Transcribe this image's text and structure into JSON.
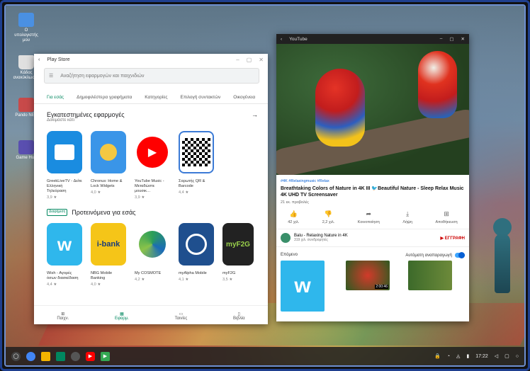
{
  "desktop": {
    "icons": [
      {
        "label": "Ο υπολογιστής μου",
        "icon": "computer-icon",
        "color": "#4a90e2"
      },
      {
        "label": "Κάδος ανακύκλωσης",
        "icon": "trash-icon",
        "color": "#e0e0e0"
      },
      {
        "label": "Pando NES",
        "icon": "pando-icon",
        "color": "#c84a4a"
      },
      {
        "label": "Game Hub",
        "icon": "grid-app-icon",
        "color": "#5a4fb0"
      }
    ]
  },
  "playstore": {
    "title": "Play Store",
    "search_placeholder": "Αναζήτηση εφαρμογών και παιχνιδιών",
    "tabs": [
      "Για εσάς",
      "Δημοφιλέστερα γραφήματα",
      "Κατηγορίες",
      "Επιλογή συντακτών",
      "Οικογένεια"
    ],
    "active_tab": 0,
    "installed": {
      "title": "Εγκατεστημένες εφαρμογές",
      "subtitle": "Δοκιμάστε κάτι",
      "apps": [
        {
          "name": "GreekLiveTV - Δείτε Ελληνική Τηλεόραση",
          "rating": "3,9 ★",
          "color": "#1a8ce0"
        },
        {
          "name": "Chronus: Home & Lock Widgets",
          "rating": "4,0 ★",
          "color": "#3a95e8"
        },
        {
          "name": "YouTube Music - Μεταδώστε μουσικ…",
          "rating": "3,9 ★",
          "color": "#ffffff"
        },
        {
          "name": "Σαρωτής QR & Barcode",
          "rating": "4,4 ★",
          "color": "#ffffff"
        }
      ]
    },
    "recommended": {
      "badge": "Διαφήμιση",
      "title": "Προτεινόμενα για εσάς",
      "apps": [
        {
          "name": "Wish - Αγορές όσων διασκέδαση",
          "rating": "4,4 ★",
          "color": "#2fb7ec",
          "text": "w"
        },
        {
          "name": "NBG Mobile Banking",
          "rating": "4,0 ★",
          "color": "#f5c518",
          "text": "i-bank"
        },
        {
          "name": "My COSMOTE",
          "rating": "4,2 ★",
          "color": "#ffffff",
          "text": ""
        },
        {
          "name": "myAlpha Mobile",
          "rating": "4,1 ★",
          "color": "#1f4f8e",
          "text": ""
        },
        {
          "name": "myF2G",
          "rating": "3,5 ★",
          "color": "#222222",
          "text": "myF2G"
        }
      ]
    },
    "nav": [
      {
        "label": "Παιχν.",
        "icon": "gamepad-icon"
      },
      {
        "label": "Εφαρμ.",
        "icon": "apps-icon"
      },
      {
        "label": "Ταινίες",
        "icon": "film-icon"
      },
      {
        "label": "Βιβλία",
        "icon": "book-icon"
      }
    ],
    "active_nav": 1
  },
  "youtube": {
    "title": "YouTube",
    "tags": "#4K #Relaxingmusic #Relax",
    "video_title": "Breathtaking Colors of Nature in 4K III 🐦Beautiful Nature - Sleep Relax Music 4K UHD TV Screensaver",
    "views": "21 εκ. προβολές",
    "actions": [
      {
        "label": "42 χιλ.",
        "icon": "like-icon"
      },
      {
        "label": "2,2 χιλ.",
        "icon": "dislike-icon"
      },
      {
        "label": "Κοινοποίηση",
        "icon": "share-icon"
      },
      {
        "label": "Λήψη",
        "icon": "download-icon"
      },
      {
        "label": "Αποθήκευση",
        "icon": "save-icon"
      }
    ],
    "channel": {
      "name": "Balu - Relaxing Nature in 4K",
      "subs": "319 χιλ. συνδρομητές",
      "subscribe": "ΕΓΓΡΑΦΗ"
    },
    "upnext_label": "Επόμενο",
    "autoplay_label": "Αυτόματη αναπαραγωγή",
    "thumb_durations": [
      "2:00:46",
      ""
    ]
  },
  "shelf": {
    "apps": [
      {
        "icon": "launcher-icon",
        "color": "#444"
      },
      {
        "icon": "chrome-icon",
        "color": "#4285f4"
      },
      {
        "icon": "files-icon",
        "color": "#f4b400"
      },
      {
        "icon": "playstore-icon",
        "color": "#01875f"
      },
      {
        "icon": "camera-icon",
        "color": "#555"
      },
      {
        "icon": "youtube-icon",
        "color": "#ff0000"
      },
      {
        "icon": "store-icon",
        "color": "#34a853"
      }
    ],
    "clock": "17:22"
  }
}
